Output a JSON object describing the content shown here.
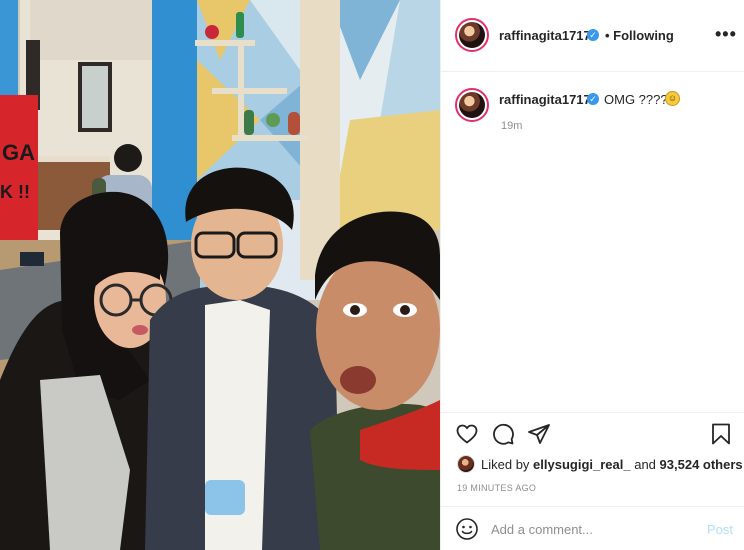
{
  "post": {
    "username": "raffinagita1717",
    "verified_badge": "✓",
    "follow_status": "• Following",
    "more_glyph": "•••"
  },
  "caption": {
    "username": "raffinagita1717",
    "text": "OMG ????",
    "emoji_glyph": "☺",
    "timestamp": "19m"
  },
  "photo": {
    "sign_text_1": "GA",
    "sign_text_2": "K !!"
  },
  "actions": {
    "like_icon": "heart-icon",
    "comment_icon": "speech-bubble-icon",
    "share_icon": "paper-plane-icon",
    "save_icon": "bookmark-icon"
  },
  "likes": {
    "prefix": "Liked by ",
    "user": "ellysugigi_real_",
    "middle": " and ",
    "count": "93,524 others"
  },
  "post_time": "19 MINUTES AGO",
  "add_comment": {
    "placeholder": "Add a comment...",
    "post_label": "Post"
  },
  "colors": {
    "accent_blue": "#3897f0",
    "post_disabled": "#b2dffc",
    "story_ring": "#e1306c",
    "muted_text": "#8e8e8e"
  }
}
